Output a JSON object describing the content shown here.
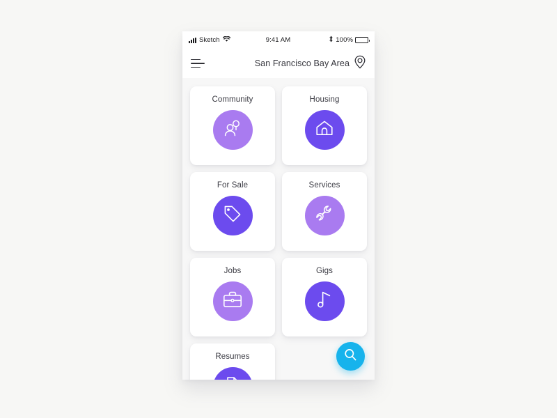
{
  "status_bar": {
    "carrier": "Sketch",
    "time": "9:41 AM",
    "battery_percent": "100%",
    "signal_icon": "signal-bars-icon",
    "wifi_icon": "wifi-icon",
    "bluetooth_icon": "bluetooth-icon",
    "battery_icon": "battery-full-icon"
  },
  "nav_bar": {
    "menu_icon": "hamburger-menu-icon",
    "title": "San Francisco Bay Area",
    "location_icon": "map-pin-icon"
  },
  "categories": [
    {
      "label": "Community",
      "icon": "people-icon",
      "circle_color": "#a97bf0"
    },
    {
      "label": "Housing",
      "icon": "house-icon",
      "circle_color": "#6c4bee"
    },
    {
      "label": "For Sale",
      "icon": "price-tag-icon",
      "circle_color": "#6c4bee"
    },
    {
      "label": "Services",
      "icon": "wrench-icon",
      "circle_color": "#a97bf0"
    },
    {
      "label": "Jobs",
      "icon": "briefcase-icon",
      "circle_color": "#a97bf0"
    },
    {
      "label": "Gigs",
      "icon": "music-note-icon",
      "circle_color": "#6c4bee"
    },
    {
      "label": "Resumes",
      "icon": "document-icon",
      "circle_color": "#6c4bee"
    }
  ],
  "fab": {
    "icon": "search-icon",
    "color": "#16b3ec"
  },
  "theme": {
    "page_background": "#f7f7f5",
    "screen_background": "#f7f7f7",
    "card_background": "#ffffff",
    "label_color": "#3a3a42",
    "accent_light_purple": "#a97bf0",
    "accent_deep_purple": "#6c4bee",
    "accent_cyan": "#16b3ec"
  }
}
